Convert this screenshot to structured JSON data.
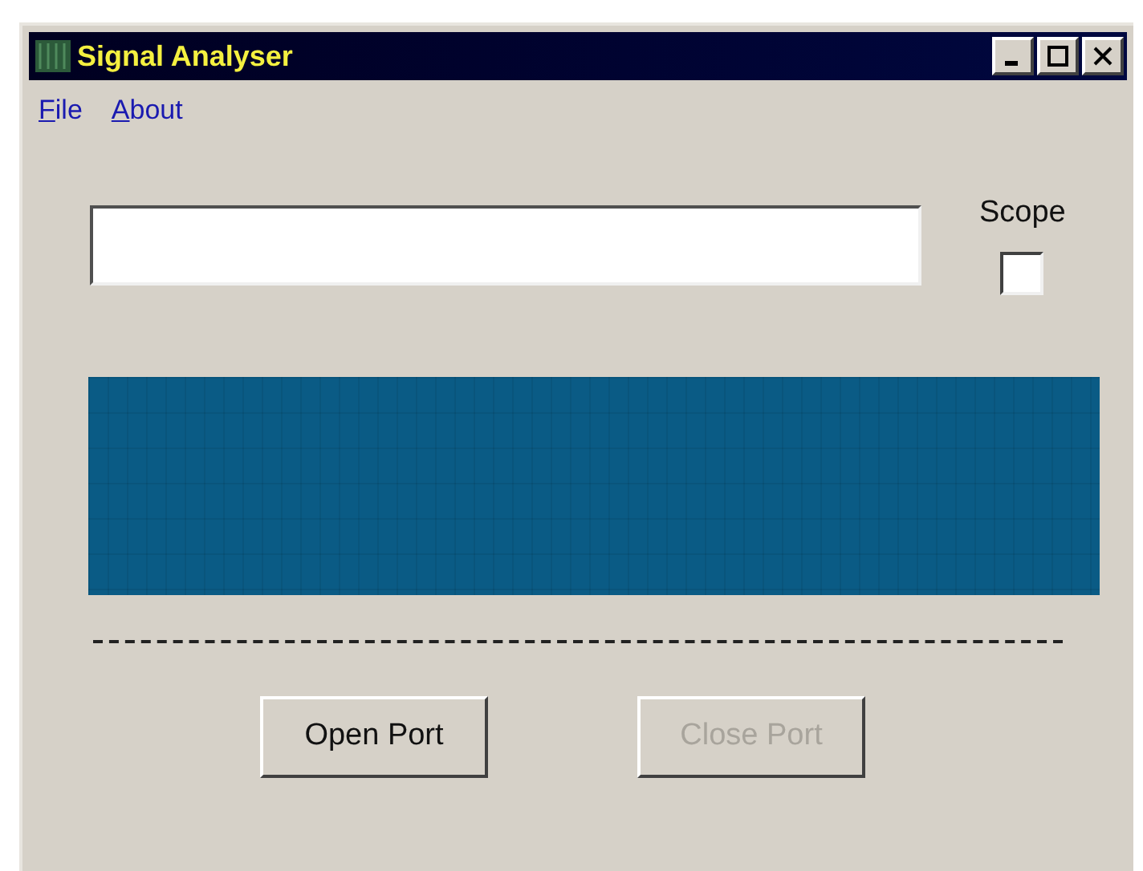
{
  "window": {
    "title": "Signal Analyser"
  },
  "menu": [
    {
      "label": "File",
      "mnemonic_underlined": true
    },
    {
      "label": "About",
      "mnemonic_underlined": true
    }
  ],
  "scope": {
    "label": "Scope",
    "checked": false
  },
  "buttons": [
    {
      "label": "Open Port",
      "disabled": false
    },
    {
      "label": "Close Port",
      "disabled": true
    }
  ]
}
